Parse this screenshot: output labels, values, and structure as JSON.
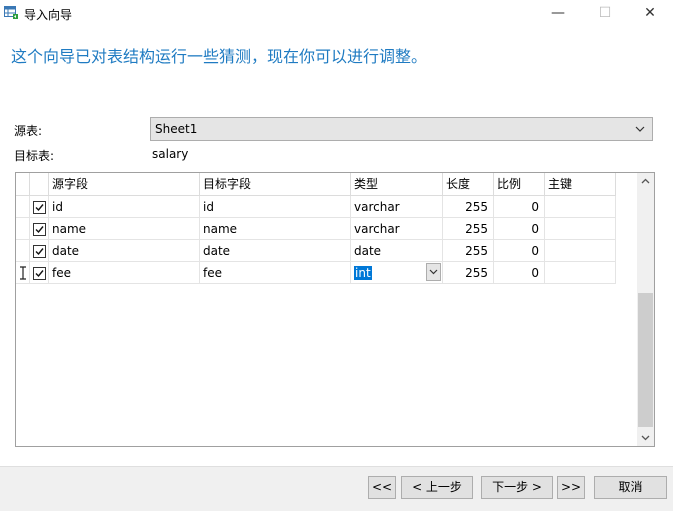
{
  "window": {
    "title": "导入向导",
    "minimize": "—",
    "maximize": "☐",
    "close": "✕"
  },
  "heading": "这个向导已对表结构运行一些猜测，现在你可以进行调整。",
  "source": {
    "label": "源表:",
    "value": "Sheet1"
  },
  "target": {
    "label": "目标表:",
    "value": "salary"
  },
  "grid": {
    "columns": [
      "源字段",
      "目标字段",
      "类型",
      "长度",
      "比例",
      "主键"
    ],
    "rows": [
      {
        "checked": true,
        "source": "id",
        "target": "id",
        "type": "varchar",
        "length": "255",
        "scale": "0",
        "pk": ""
      },
      {
        "checked": true,
        "source": "name",
        "target": "name",
        "type": "varchar",
        "length": "255",
        "scale": "0",
        "pk": ""
      },
      {
        "checked": true,
        "source": "date",
        "target": "date",
        "type": "date",
        "length": "255",
        "scale": "0",
        "pk": ""
      },
      {
        "checked": true,
        "source": "fee",
        "target": "fee",
        "type": "int",
        "length": "255",
        "scale": "0",
        "pk": ""
      }
    ]
  },
  "buttons": {
    "first": "<<",
    "prev": "< 上一步",
    "next": "下一步 >",
    "last": ">>",
    "cancel": "取消"
  },
  "icons": {
    "app": "table-import-icon",
    "dropdown": "chevron-down-icon",
    "cursor": "text-cursor-icon"
  },
  "colors": {
    "accent": "#1f7bc2",
    "selection": "#0078d7"
  }
}
